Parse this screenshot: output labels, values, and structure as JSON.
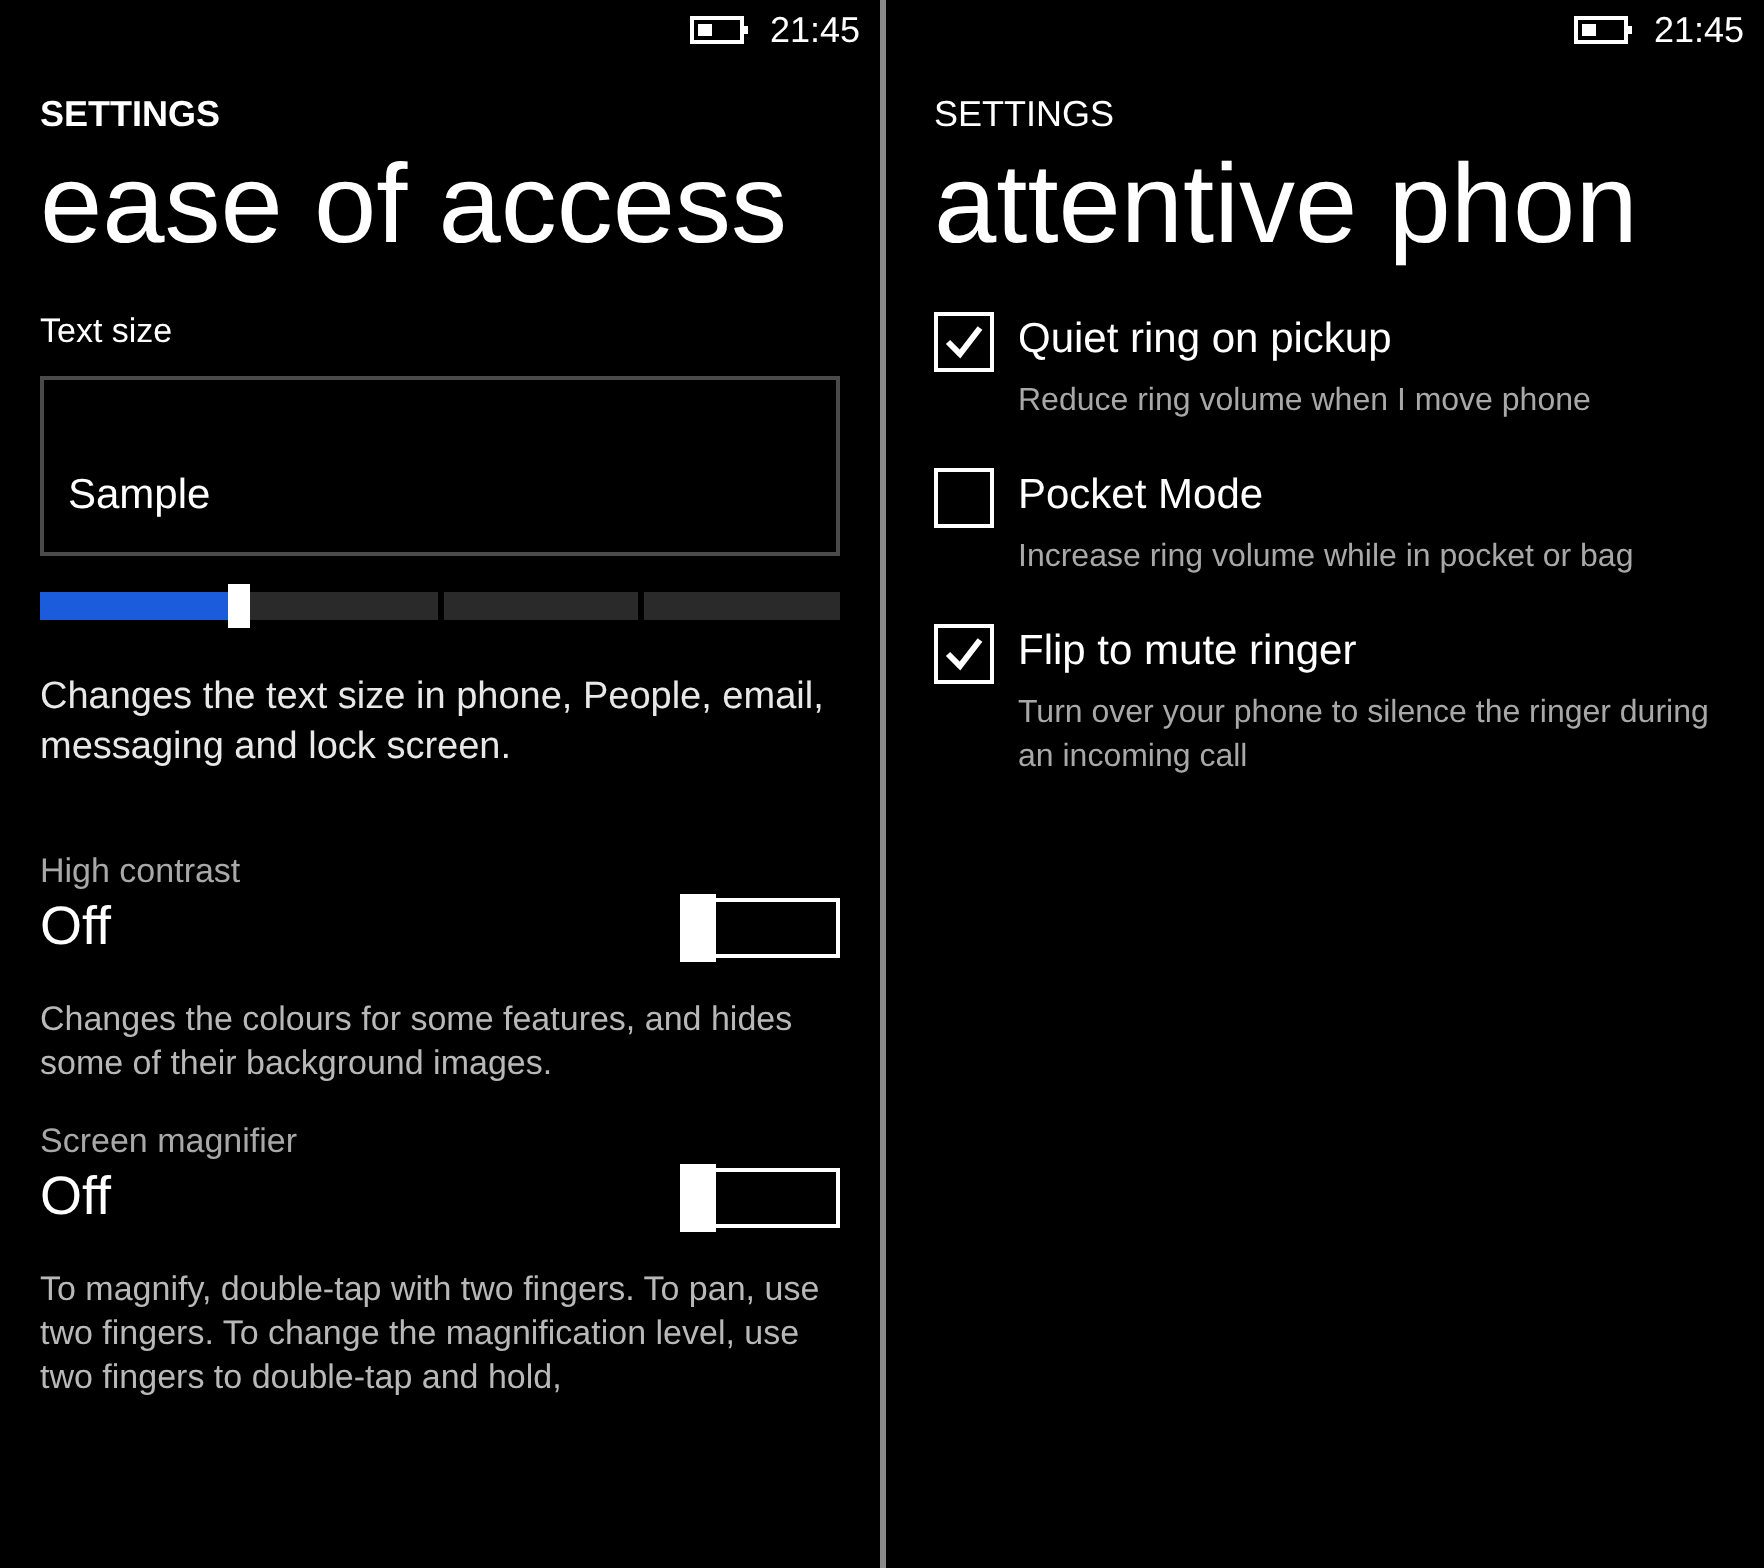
{
  "left": {
    "status_bar": {
      "time": "21:45"
    },
    "header": "SETTINGS",
    "title": "ease of access",
    "text_size": {
      "label": "Text size",
      "sample": "Sample",
      "level": 0.25,
      "description": "Changes the text size in phone, People, email, messaging and lock screen."
    },
    "toggles": [
      {
        "label": "High contrast",
        "state": "Off",
        "on": false,
        "description": "Changes the colours for some features, and hides some of their background images."
      },
      {
        "label": "Screen magnifier",
        "state": "Off",
        "on": false,
        "description": "To magnify, double-tap with two fingers. To pan, use two fingers. To change the magnification level, use two fingers to double-tap and hold,"
      }
    ]
  },
  "right": {
    "status_bar": {
      "time": "21:45"
    },
    "header": "SETTINGS",
    "title": "attentive phon",
    "options": [
      {
        "label": "Quiet ring on pickup",
        "description": "Reduce ring volume when I move phone",
        "checked": true
      },
      {
        "label": "Pocket Mode",
        "description": "Increase ring volume while in pocket or bag",
        "checked": false
      },
      {
        "label": "Flip to mute ringer",
        "description": "Turn over your phone to silence the ringer during an incoming call",
        "checked": true
      }
    ]
  }
}
